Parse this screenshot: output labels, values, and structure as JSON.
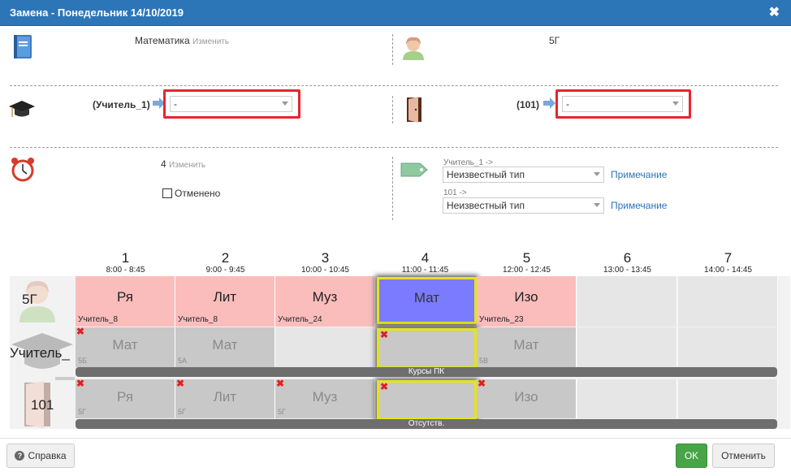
{
  "dialog": {
    "title": "Замена - Понедельник 14/10/2019",
    "close_icon": "✖"
  },
  "subject": {
    "value": "Математика",
    "change": "Изменить"
  },
  "group": {
    "value": "5Г"
  },
  "teacher": {
    "label": "(Учитель_1)",
    "selected": "-"
  },
  "room": {
    "label": "(101)",
    "selected": "-"
  },
  "lesson": {
    "value": "4",
    "change": "Изменить",
    "cancelled_label": "Отменено"
  },
  "types": {
    "teacher_caption": "Учитель_1 ->",
    "teacher_type": "Неизвестный тип",
    "room_caption": "101 ->",
    "room_type": "Неизвестный тип",
    "note_label": "Примечание"
  },
  "schedule": {
    "periods": [
      {
        "n": "1",
        "time": "8:00 - 8:45"
      },
      {
        "n": "2",
        "time": "9:00 - 9:45"
      },
      {
        "n": "3",
        "time": "10:00 - 10:45"
      },
      {
        "n": "4",
        "time": "11:00 - 11:45"
      },
      {
        "n": "5",
        "time": "12:00 - 12:45"
      },
      {
        "n": "6",
        "time": "13:00 - 13:45"
      },
      {
        "n": "7",
        "time": "14:00 - 14:45"
      }
    ],
    "row_labels": {
      "group": "5Г",
      "teacher": "Учитель_",
      "room": "101"
    },
    "group_row": [
      {
        "subj": "Ря",
        "sub": "Учитель_8",
        "style": "pink"
      },
      {
        "subj": "Лит",
        "sub": "Учитель_8",
        "style": "pink"
      },
      {
        "subj": "Муз",
        "sub": "Учитель_24",
        "style": "pink"
      },
      {
        "subj": "Мат",
        "sub": "",
        "style": "sel-hi"
      },
      {
        "subj": "Изо",
        "sub": "Учитель_23",
        "style": "pink"
      },
      {
        "subj": "",
        "sub": "",
        "style": "empty"
      },
      {
        "subj": "",
        "sub": "",
        "style": "empty"
      }
    ],
    "teacher_row": [
      {
        "subj": "Мат",
        "sub": "5Б",
        "style": "grey",
        "x": true
      },
      {
        "subj": "Мат",
        "sub": "5А",
        "style": "grey",
        "x": false
      },
      {
        "subj": "",
        "sub": "",
        "style": "empty",
        "x": false
      },
      {
        "subj": "",
        "sub": "",
        "style": "grey-hi",
        "x": true
      },
      {
        "subj": "Мат",
        "sub": "5В",
        "style": "grey",
        "x": false
      },
      {
        "subj": "",
        "sub": "",
        "style": "empty",
        "x": false
      },
      {
        "subj": "",
        "sub": "",
        "style": "empty",
        "x": false
      }
    ],
    "teacher_bar": "Курсы ПК",
    "room_row": [
      {
        "subj": "Ря",
        "sub": "5Г",
        "style": "grey",
        "x": true
      },
      {
        "subj": "Лит",
        "sub": "5Г",
        "style": "grey",
        "x": true
      },
      {
        "subj": "Муз",
        "sub": "5Г",
        "style": "grey",
        "x": true
      },
      {
        "subj": "",
        "sub": "",
        "style": "grey-hi",
        "x": true
      },
      {
        "subj": "Изо",
        "sub": "",
        "style": "grey",
        "x": true
      },
      {
        "subj": "",
        "sub": "",
        "style": "empty",
        "x": false
      },
      {
        "subj": "",
        "sub": "",
        "style": "empty",
        "x": false
      }
    ],
    "room_bar": "Отсутств."
  },
  "footer": {
    "help": "Справка",
    "ok": "OK",
    "cancel": "Отменить"
  }
}
